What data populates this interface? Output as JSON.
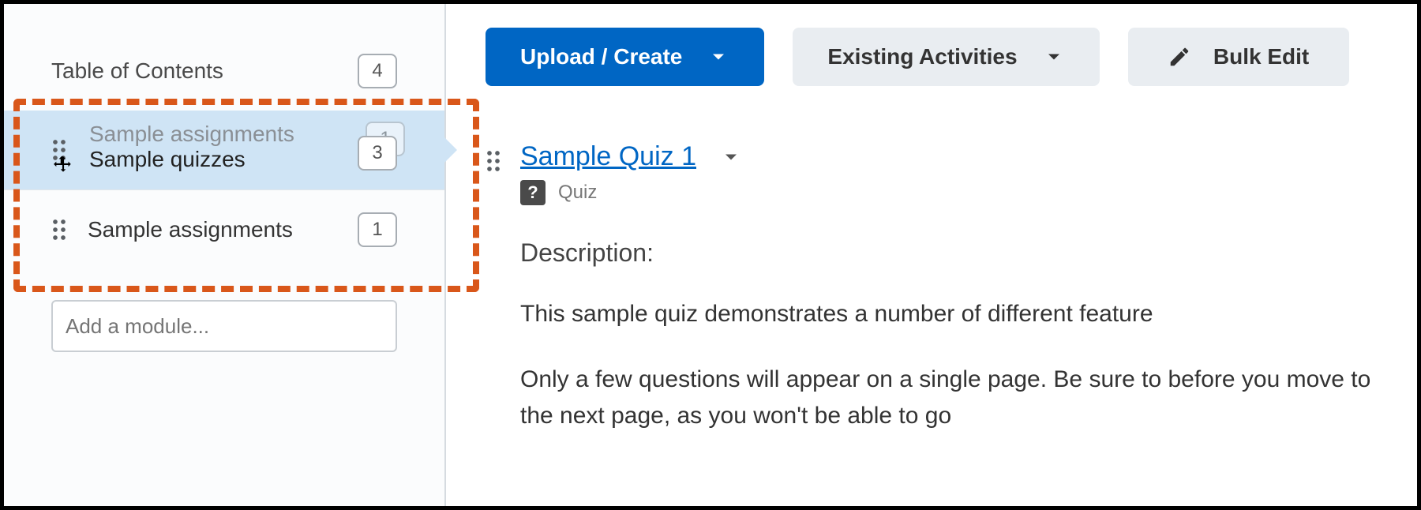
{
  "sidebar": {
    "toc_label": "Table of Contents",
    "toc_count": "4",
    "dragging": {
      "ghost_label": "Sample assignments",
      "ghost_count": "1",
      "drag_label": "Sample quizzes",
      "drag_count": "3"
    },
    "module_below": {
      "label": "Sample assignments",
      "count": "1"
    },
    "add_module_placeholder": "Add a module..."
  },
  "toolbar": {
    "upload_create_label": "Upload / Create",
    "existing_activities_label": "Existing Activities",
    "bulk_edit_label": "Bulk Edit"
  },
  "content": {
    "title": "Sample Quiz 1",
    "type_label": "Quiz",
    "type_icon_glyph": "?",
    "description_heading": "Description:",
    "description_p1": "This sample quiz demonstrates a number of different feature",
    "description_p2": "Only a few questions will appear on a single page. Be sure to before you move to the next page, as you won't be able to go"
  }
}
